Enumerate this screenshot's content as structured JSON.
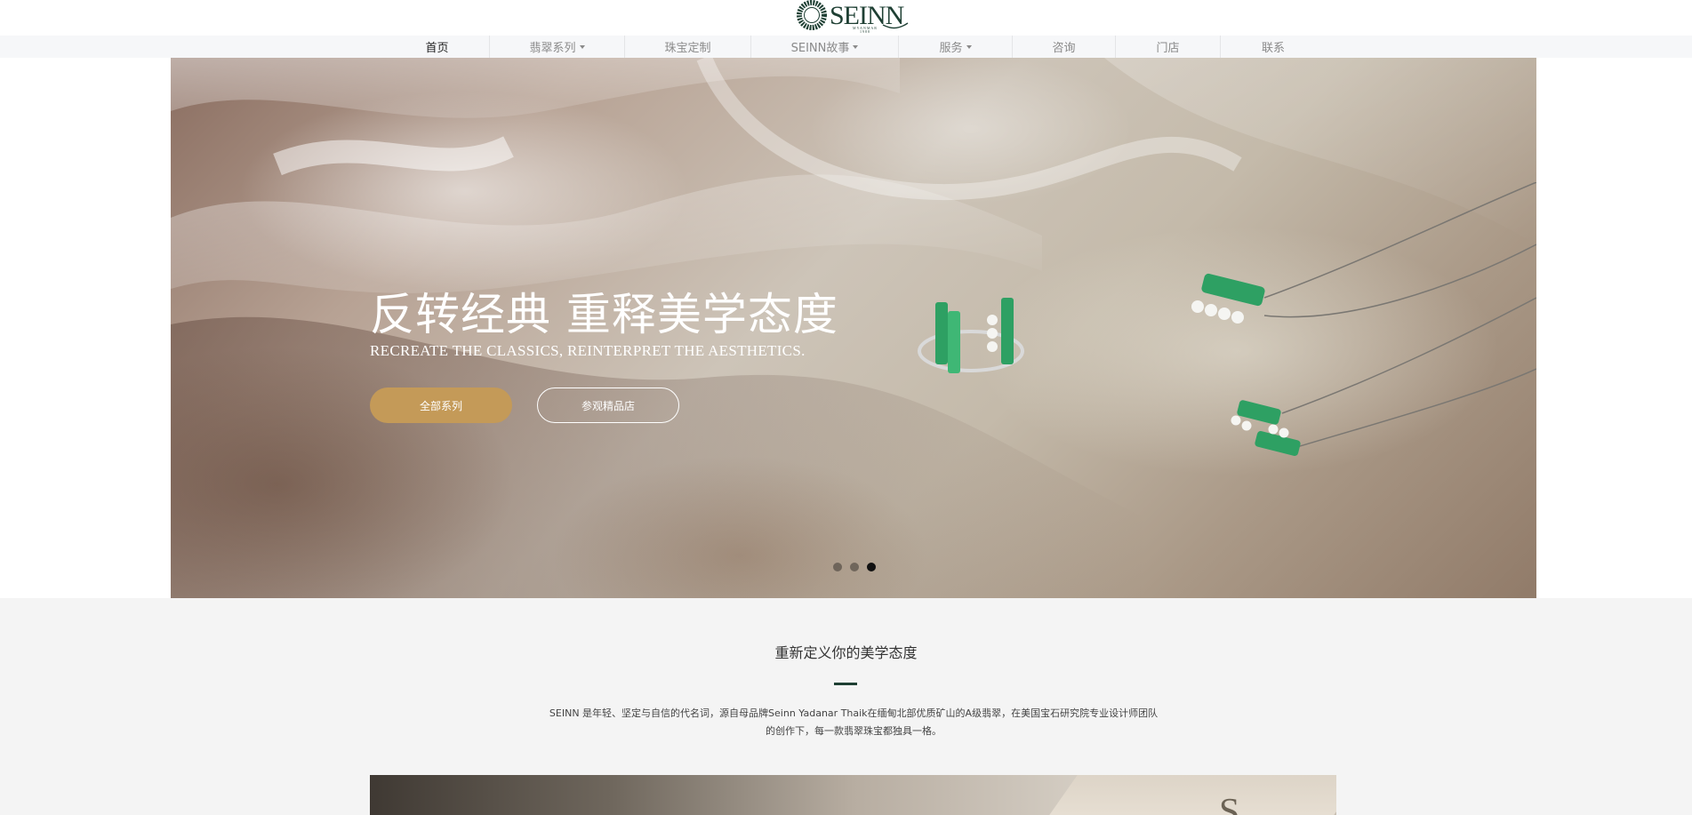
{
  "brand": {
    "name": "SEINN",
    "sub_mark": "MYANMAR 1988",
    "color": "#1e3f33"
  },
  "nav": {
    "items": [
      {
        "label": "首页",
        "active": true,
        "dropdown": false
      },
      {
        "label": "翡翠系列",
        "active": false,
        "dropdown": true
      },
      {
        "label": "珠宝定制",
        "active": false,
        "dropdown": false
      },
      {
        "label": "SEINN故事",
        "active": false,
        "dropdown": true
      },
      {
        "label": "服务",
        "active": false,
        "dropdown": true
      },
      {
        "label": "咨询",
        "active": false,
        "dropdown": false
      },
      {
        "label": "门店",
        "active": false,
        "dropdown": false
      },
      {
        "label": "联系",
        "active": false,
        "dropdown": false
      }
    ]
  },
  "hero": {
    "title": "反转经典 重释美学态度",
    "subtitle": "RECREATE THE CLASSICS, REINTERPRET THE AESTHETICS.",
    "primary_button": "全部系列",
    "secondary_button": "参观精品店",
    "slides_total": 3,
    "active_slide": 3,
    "accent_color": "#c49a58"
  },
  "intro": {
    "title": "重新定义你的美学态度",
    "text": "SEINN 是年轻、坚定与自信的代名词，源自母品牌Seinn Yadanar Thaik在缅甸北部优质矿山的A级翡翠，在美国宝石研究院专业设计师团队的创作下，每一款翡翠珠宝都独具一格。"
  }
}
